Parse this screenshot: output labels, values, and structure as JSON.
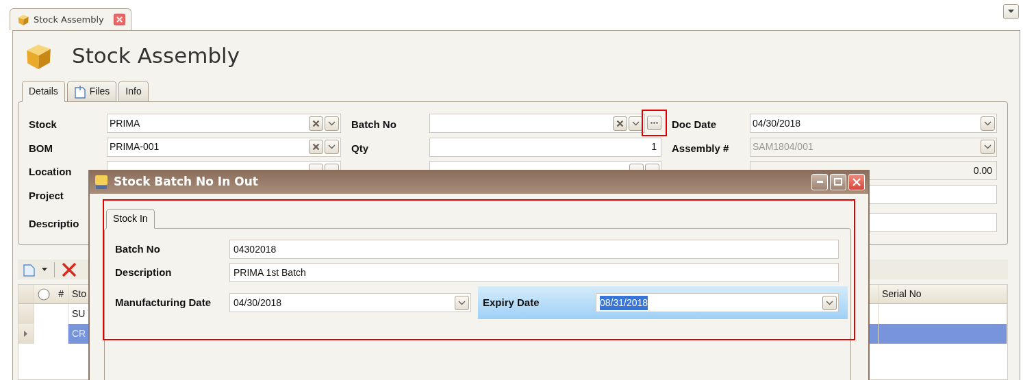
{
  "document_tab": {
    "label": "Stock Assembly",
    "selected": true
  },
  "page_title": "Stock Assembly",
  "tabs": [
    {
      "label": "Details",
      "selected": true,
      "kind": "plain"
    },
    {
      "label": "Files",
      "selected": false,
      "kind": "file"
    },
    {
      "label": "Info",
      "selected": false,
      "kind": "plain"
    }
  ],
  "form": {
    "columns": [
      [
        {
          "label": "Stock",
          "value": "PRIMA",
          "kind": "lookup"
        },
        {
          "label": "BOM",
          "value": "PRIMA-001",
          "kind": "lookup"
        },
        {
          "label": "Location",
          "kind": "lookup-partial"
        },
        {
          "label": "Project"
        },
        {
          "label": "Descriptio"
        }
      ],
      [
        {
          "label": "Batch No",
          "kind": "lookup-more",
          "highlighted": true
        },
        {
          "label": "Qty",
          "value": "1",
          "kind": "number"
        },
        {
          "kind": "lookup-partial"
        }
      ],
      [
        {
          "label": "Doc Date",
          "value": "04/30/2018",
          "kind": "dropdown"
        },
        {
          "label": "Assembly #",
          "value": "SAM1804/001",
          "kind": "dropdown",
          "disabled": true
        },
        {
          "value": "0.00",
          "kind": "number",
          "disabled": true
        },
        {
          "kind": "text"
        },
        {
          "kind": "text"
        }
      ]
    ]
  },
  "grid": {
    "columns": [
      {
        "label": "#"
      },
      {
        "label": "Sto"
      },
      {
        "label": "Serial No"
      }
    ],
    "rows": [
      {
        "stock": "SU",
        "selected": false
      },
      {
        "stock": "CR",
        "selected": true
      }
    ]
  },
  "dialog": {
    "title": "Stock Batch No In Out",
    "highlighted": true,
    "tabs": [
      {
        "label": "Stock In",
        "selected": true
      }
    ],
    "fields": [
      {
        "label": "Batch No",
        "value": "04302018",
        "kind": "text",
        "focused": false
      },
      {
        "label": "Description",
        "value": "PRIMA 1st Batch",
        "kind": "text",
        "focused": false
      },
      {
        "label": "Manufacturing Date",
        "value": "04/30/2018",
        "kind": "date",
        "focused": false
      },
      {
        "label": "Expiry Date",
        "value": "08/31/2018",
        "kind": "date",
        "focused": true
      }
    ]
  }
}
